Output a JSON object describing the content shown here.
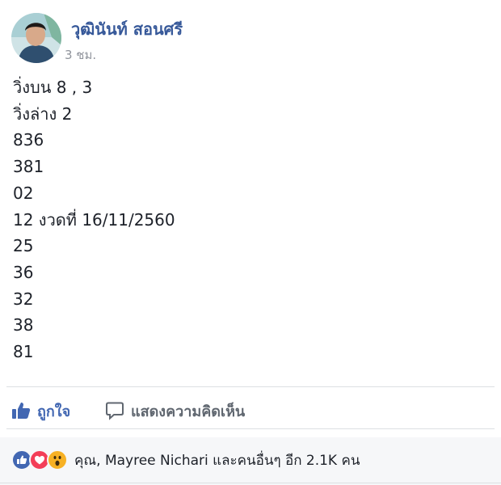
{
  "post": {
    "author": "วุฒินันท์ สอนศรี",
    "time": "3 ชม.",
    "lines": [
      "วิ่งบน 8 , 3",
      "วิ่งล่าง 2",
      "836",
      "381",
      "02",
      "12 งวดที่ 16/11/2560",
      "25",
      "36",
      "32",
      "38",
      "81"
    ]
  },
  "actions": {
    "like_label": "ถูกใจ",
    "comment_label": "แสดงความคิดเห็น"
  },
  "reactions": {
    "summary": "คุณ, Mayree Nichari และคนอื่นๆ อีก 2.1K คน",
    "icons": [
      "like-reaction-icon",
      "love-reaction-icon",
      "wow-reaction-icon"
    ]
  },
  "colors": {
    "link_blue": "#365899",
    "like_blue": "#4267b2",
    "muted_gray": "#90949c",
    "love_red": "#f33e58",
    "wow_yellow": "#f7b125"
  }
}
